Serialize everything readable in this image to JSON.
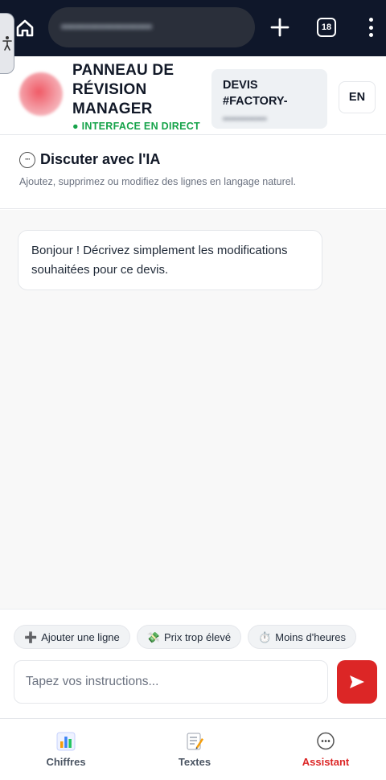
{
  "browser": {
    "url": "•••••••••••••••••••",
    "tab_count": "18"
  },
  "header": {
    "title": "PANNEAU DE RÉVISION MANAGER",
    "live_status": "● INTERFACE EN DIRECT",
    "quote_label": "DEVIS #FACTORY-",
    "quote_id": "••••••••••••",
    "language": "EN"
  },
  "assistant": {
    "title": "Discuter avec l'IA",
    "subtitle": "Ajoutez, supprimez ou modifiez des lignes en langage naturel."
  },
  "messages": [
    {
      "text": "Bonjour ! Décrivez simplement les modifications souhaitées pour ce devis."
    }
  ],
  "quick_actions": [
    {
      "icon": "➕",
      "label": "Ajouter une ligne"
    },
    {
      "icon": "💸",
      "label": "Prix trop élevé"
    },
    {
      "icon": "⏱️",
      "label": "Moins d'heures"
    }
  ],
  "composer": {
    "placeholder": "Tapez vos instructions..."
  },
  "bottom_nav": [
    {
      "label": "Chiffres",
      "icon": "bar-chart-icon",
      "active": false
    },
    {
      "label": "Textes",
      "icon": "memo-icon",
      "active": false
    },
    {
      "label": "Assistant",
      "icon": "chat-bubble-icon",
      "active": true
    }
  ],
  "colors": {
    "accent": "#dc2626",
    "live": "#16a34a",
    "browser_bar": "#0f172a"
  }
}
